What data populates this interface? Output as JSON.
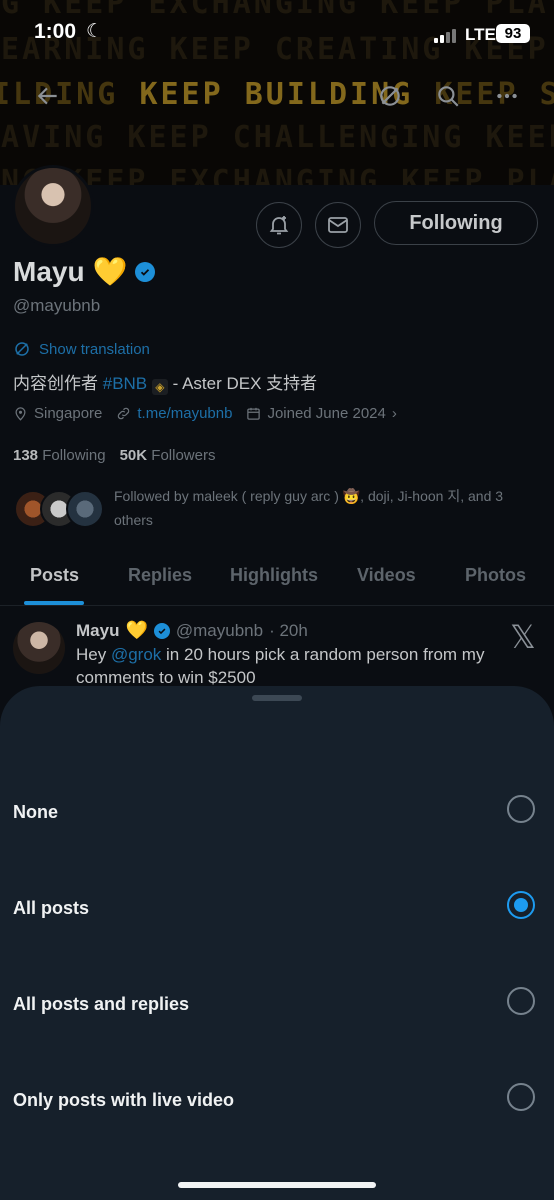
{
  "status_bar": {
    "time": "1:00",
    "carrier": "LTE",
    "battery": "93"
  },
  "banner": {
    "lines": [
      "NG KEEP EXCHANGING KEEP PLAYING",
      "LEARNING KEEP CREATING KEEP LE",
      "ILDING",
      "KEEP BUILDING",
      "KEEP SA",
      "SAVING KEEP CHALLENGING KEEP",
      "ING KEEP EXCHANGING KEEP PLAY"
    ]
  },
  "profile": {
    "follow_label": "Following",
    "name": "Mayu",
    "name_emoji": "💛",
    "handle": "@mayubnb",
    "show_translation": "Show translation",
    "bio_prefix": "内容创作者",
    "bio_tag": "#BNB",
    "bio_suffix": "- Aster DEX 支持者",
    "location": "Singapore",
    "link": "t.me/mayubnb",
    "joined": "Joined June 2024",
    "following_count": "138",
    "following_label": "Following",
    "followers_count": "50K",
    "followers_label": "Followers",
    "followed_by": "Followed by maleek ( reply guy arc ) 🤠, doji, Ji-hoon 지, and 3 others"
  },
  "tabs": [
    "Posts",
    "Replies",
    "Highlights",
    "Videos",
    "Photos"
  ],
  "post": {
    "name": "Mayu",
    "name_emoji": "💛",
    "handle": "@mayubnb",
    "time": "· 20h",
    "text_prefix": "Hey",
    "mention": "@grok",
    "text_suffix": "in 20 hours pick a random person from my comments to win $2500"
  },
  "notification_sheet": {
    "options": [
      {
        "label": "None",
        "selected": false
      },
      {
        "label": "All posts",
        "selected": true
      },
      {
        "label": "All posts and replies",
        "selected": false
      },
      {
        "label": "Only posts with live video",
        "selected": false
      }
    ]
  },
  "colors": {
    "accent": "#1d9bf0",
    "sheet_bg": "#16202b",
    "gold": "#c9a02b"
  }
}
